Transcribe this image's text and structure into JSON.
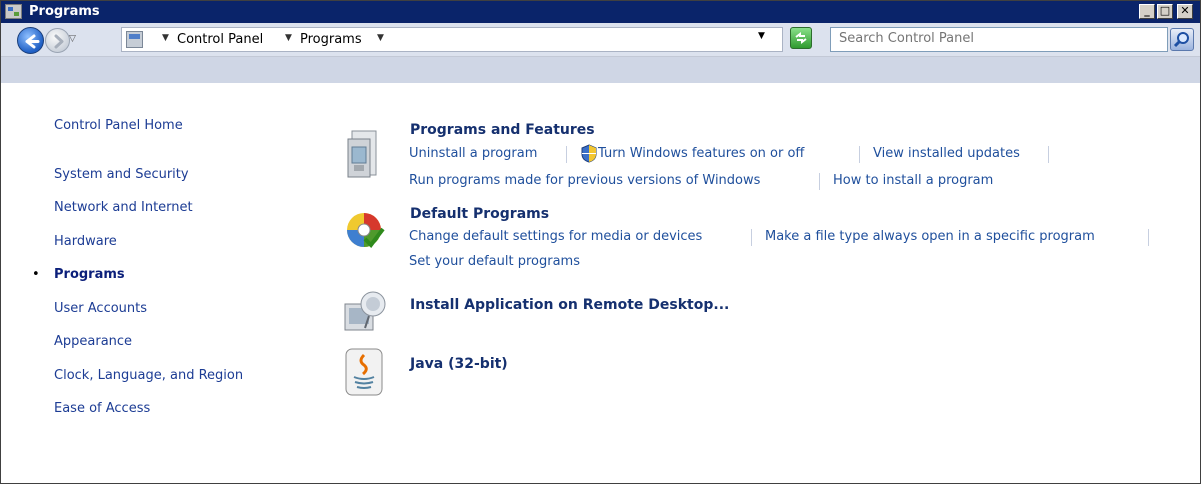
{
  "window": {
    "title": "Programs"
  },
  "titlebar": {
    "minimize": "_",
    "maximize": "□",
    "close": "✕"
  },
  "address": {
    "breadcrumbs": [
      "Control Panel",
      "Programs"
    ],
    "search_placeholder": "Search Control Panel"
  },
  "sidebar": {
    "home": "Control Panel Home",
    "items": [
      {
        "label": "System and Security"
      },
      {
        "label": "Network and Internet"
      },
      {
        "label": "Hardware"
      },
      {
        "label": "Programs",
        "active": true
      },
      {
        "label": "User Accounts"
      },
      {
        "label": "Appearance"
      },
      {
        "label": "Clock, Language, and Region"
      },
      {
        "label": "Ease of Access"
      }
    ],
    "bullet": "•"
  },
  "categories": {
    "programs_features": {
      "title": "Programs and Features",
      "icon": "programs-features-icon",
      "links": [
        "Uninstall a program",
        "Turn Windows features on or off",
        "View installed updates",
        "Run programs made for previous versions of Windows",
        "How to install a program"
      ]
    },
    "default_programs": {
      "title": "Default Programs",
      "icon": "default-programs-icon",
      "links": [
        "Change default settings for media or devices",
        "Make a file type always open in a specific program",
        "Set your default programs"
      ]
    },
    "remote_desktop": {
      "title": "Install Application on Remote Desktop...",
      "icon": "remote-desktop-icon"
    },
    "java": {
      "title": "Java (32-bit)",
      "icon": "java-icon"
    }
  },
  "colors": {
    "titlebar": "#0a246a",
    "link": "#1f4f9c",
    "heading": "#15306f"
  }
}
